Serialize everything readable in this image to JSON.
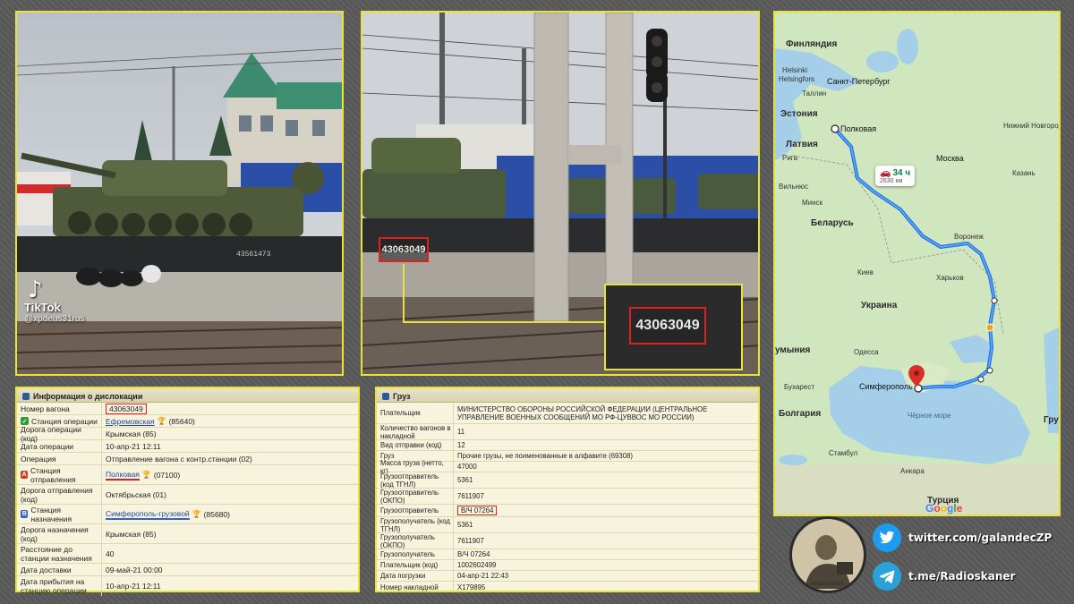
{
  "photo1": {
    "tiktok_logo": "TikTok",
    "tiktok_user": "@xpdeus31rus",
    "wagon_marking": "43561473"
  },
  "photo2": {
    "wagon_number_small": "43063049",
    "wagon_number_zoom": "43063049"
  },
  "map": {
    "countries": {
      "finland": "Финляндия",
      "estonia": "Эстония",
      "latvia": "Латвия",
      "belarus": "Беларусь",
      "ukraine": "Украина",
      "romania": "умыния",
      "bulgaria": "Болгария",
      "turkey": "Турция",
      "gr": "Гру"
    },
    "cities": {
      "helsinki": "Helsinki",
      "helsingfors": "Helsingfors",
      "tallinn": "Таллин",
      "spb": "Санкт-Петербург",
      "riga": "Рига",
      "vilnius": "Вильнюс",
      "minsk": "Минск",
      "moscow": "Москва",
      "kazan": "Казань",
      "nizhny": "Нижний Новгород",
      "voronezh": "Воронеж",
      "kiev": "Киев",
      "kharkiv": "Харьков",
      "odessa": "Одесса",
      "bucharest": "Бухарест",
      "istanbul": "Стамбул",
      "ankara": "Анкара",
      "origin": "Полковая",
      "destination": "Симферополь"
    },
    "seas": {
      "black_sea": "Чёрное море"
    },
    "route": {
      "duration": "34 ч",
      "distance": "2630 км"
    },
    "google": "Google"
  },
  "dislocation": {
    "title": "Информация о дислокации",
    "rows": [
      {
        "key": "Номер вагона",
        "value": "43063049"
      },
      {
        "key": "Станция операции",
        "value": "Ефремовская",
        "extra": "(85640)"
      },
      {
        "key": "Дорога операции (код)",
        "value": "Крымская (85)"
      },
      {
        "key": "Дата операции",
        "value": "10-апр-21  12:11"
      },
      {
        "key": "Операция",
        "value": "Отправление вагона с контр.станции (02)"
      },
      {
        "key": "Станция отправления",
        "value": "Полковая",
        "extra": "(07100)"
      },
      {
        "key": "Дорога отправления (код)",
        "value": "Октябрьская (01)"
      },
      {
        "key": "Станция назначения",
        "value": "Симферополь-грузовой",
        "extra": "(85680)"
      },
      {
        "key": "Дорога назначения (код)",
        "value": "Крымская (85)"
      },
      {
        "key": "Расстояние до станции назначения",
        "value": "40"
      },
      {
        "key": "Дата доставки",
        "value": "09-май-21  00:00"
      },
      {
        "key": "Дата прибытия на станцию операции",
        "value": "10-апр-21  12:11"
      }
    ]
  },
  "cargo": {
    "title": "Груз",
    "rows": [
      {
        "key": "Плательщик",
        "value": "МИНИСТЕРСТВО ОБОРОНЫ РОССИЙСКОЙ ФЕДЕРАЦИИ (ЦЕНТРАЛЬНОЕ УПРАВЛЕНИЕ ВОЕННЫХ СООБЩЕНИЙ МО РФ-ЦУВВОС МО РОССИИ)"
      },
      {
        "key": "Количество вагонов в накладной",
        "value": "11"
      },
      {
        "key": "Вид отправки (код)",
        "value": "12"
      },
      {
        "key": "Груз",
        "value": "Прочие грузы, не поименованные в алфавите (69308)"
      },
      {
        "key": "Масса груза (нетто, кг)",
        "value": "47000"
      },
      {
        "key": "Грузоотправитель (код ТГНЛ)",
        "value": "5361"
      },
      {
        "key": "Грузоотправитель (ОКПО)",
        "value": "7611907"
      },
      {
        "key": "Грузоотправитель",
        "value": "В/Ч 07264"
      },
      {
        "key": "Грузополучатель (код ТГНЛ)",
        "value": "5361"
      },
      {
        "key": "Грузополучатель (ОКПО)",
        "value": "7611907"
      },
      {
        "key": "Грузополучатель",
        "value": "В/Ч 07264"
      },
      {
        "key": "Плательщик (код)",
        "value": "1002602499"
      },
      {
        "key": "Дата погрузки",
        "value": "04-апр-21  22:43"
      },
      {
        "key": "Номер накладной",
        "value": "Х179895"
      }
    ]
  },
  "social": {
    "twitter": "twitter.com/galandecZP",
    "telegram": "t.me/Radioskaner",
    "avatar_caption": "RADIOSKANER"
  },
  "colors": {
    "frame": "#e8e23a",
    "highlight": "#e0201f",
    "link": "#2347a6"
  }
}
